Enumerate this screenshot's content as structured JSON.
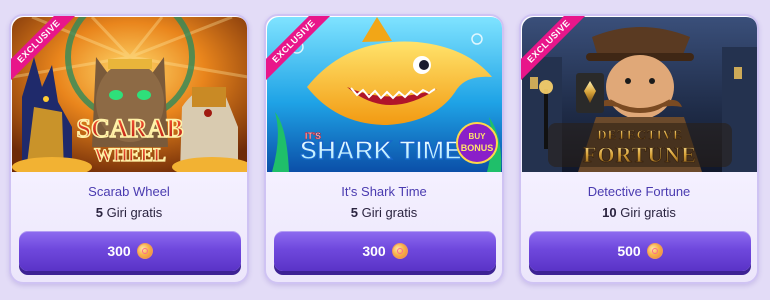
{
  "games": [
    {
      "badge": "EXCLUSIVE",
      "art_title": "SCARAB",
      "art_subtitle": "WHEEL",
      "title": "Scarab Wheel",
      "spins_count": "5",
      "spins_label": "Giri gratis",
      "price": "300",
      "price_icon": "coin-icon"
    },
    {
      "badge": "EXCLUSIVE",
      "art_prefix": "IT'S",
      "art_title": "SHARK TIME!",
      "art_extra_top": "BUY",
      "art_extra_bottom": "BONUS",
      "title": "It's Shark Time",
      "spins_count": "5",
      "spins_label": "Giri gratis",
      "price": "300",
      "price_icon": "coin-icon"
    },
    {
      "badge": "EXCLUSIVE",
      "art_title": "DETECTIVE",
      "art_subtitle": "FORTUNE",
      "title": "Detective Fortune",
      "spins_count": "10",
      "spins_label": "Giri gratis",
      "price": "500",
      "price_icon": "coin-icon"
    }
  ],
  "colors": {
    "page_bg": "#e3dcf7",
    "badge": "#e8168a",
    "title": "#4a3bb0",
    "button": "#6f48dd"
  }
}
